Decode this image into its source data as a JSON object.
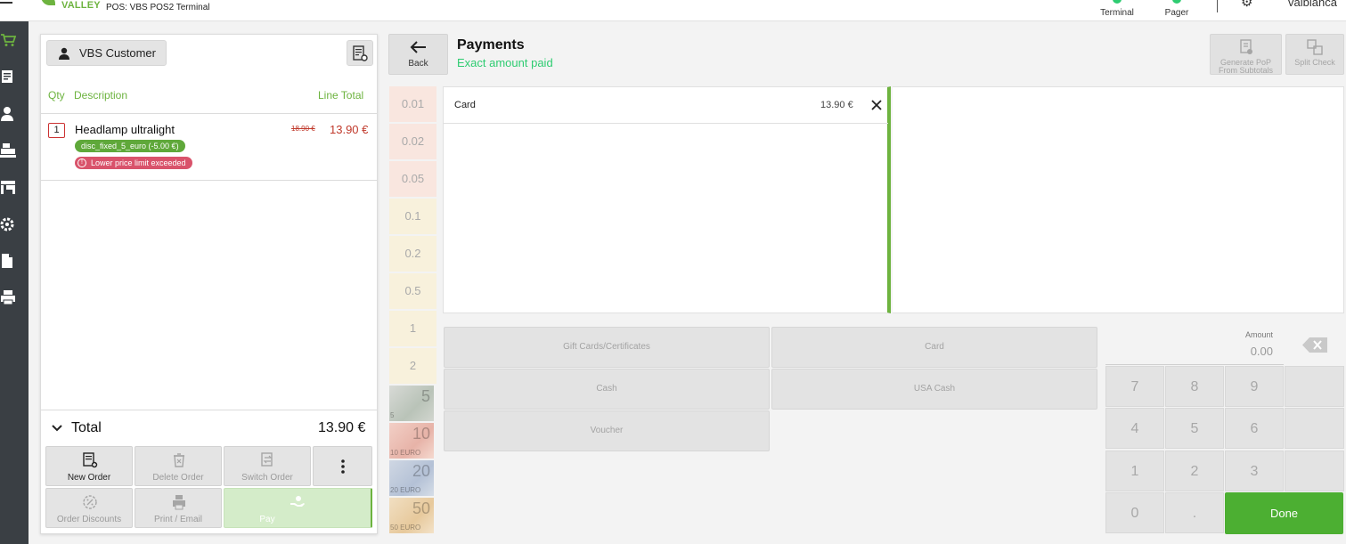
{
  "topbar": {
    "logo_text": "VALLEY",
    "pos_title": "POS: VBS POS2 Terminal",
    "terminal_label": "Terminal",
    "pager_label": "Pager",
    "user_name": "valbianca"
  },
  "order": {
    "customer_label": "VBS Customer",
    "headers": {
      "qty": "Qty",
      "description": "Description",
      "line_total": "Line Total"
    },
    "items": [
      {
        "qty": "1",
        "name": "Headlamp ultralight",
        "old_price": "18.90 €",
        "price": "13.90 €",
        "discount_tag": "disc_fixed_5_euro (-5.00 €)",
        "warning_tag": "Lower price limit exceeded"
      }
    ],
    "total_label": "Total",
    "total_value": "13.90 €",
    "actions": {
      "new_order": "New Order",
      "delete_order": "Delete Order",
      "switch_order": "Switch Order",
      "order_discounts": "Order Discounts",
      "print_email": "Print / Email",
      "pay": "Pay"
    }
  },
  "payments": {
    "back_label": "Back",
    "title": "Payments",
    "subtitle": "Exact amount paid",
    "generate_pop": "Generate PoP From Subtotals",
    "split_check": "Split Check",
    "denominations": [
      "0.01",
      "0.02",
      "0.05",
      "0.1",
      "0.2",
      "0.5",
      "1",
      "2"
    ],
    "notes": [
      {
        "value": "5",
        "small": "5"
      },
      {
        "value": "10",
        "small": "10 EURO"
      },
      {
        "value": "20",
        "small": "20 EURO"
      },
      {
        "value": "50",
        "small": "50 EURO"
      }
    ],
    "entries": [
      {
        "name": "Card",
        "amount": "13.90 €"
      }
    ],
    "tenders": {
      "gift_cards": "Gift Cards/Certificates",
      "card": "Card",
      "cash": "Cash",
      "usa_cash": "USA Cash",
      "voucher": "Voucher"
    },
    "amount_label": "Amount",
    "amount_value": "0.00",
    "keypad": [
      "7",
      "8",
      "9",
      "4",
      "5",
      "6",
      "1",
      "2",
      "3",
      "0",
      "."
    ],
    "done_label": "Done"
  },
  "colors": {
    "accent_green": "#6db33f",
    "done_green": "#4caf32",
    "price_red": "#c0392b",
    "warn_pink": "#d9536b",
    "rail_dark": "#3a3f44"
  }
}
